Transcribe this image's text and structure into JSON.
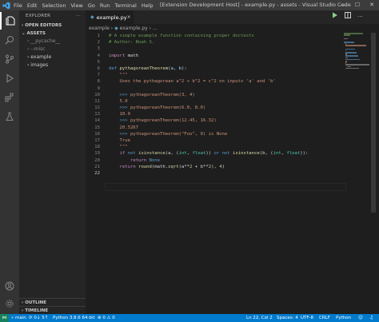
{
  "titlebar": {
    "menu": [
      "File",
      "Edit",
      "Selection",
      "View",
      "Go",
      "Run",
      "Terminal",
      "Help"
    ],
    "title": "[Extension Development Host] - example.py - assets - Visual Studio Code",
    "minimize": "—",
    "maximize": "☐",
    "close": "✕"
  },
  "sidebar": {
    "header": "EXPLORER",
    "more": "···",
    "open_editors": "OPEN EDITORS",
    "folder": "ASSETS",
    "items": [
      {
        "label": "› __pycache__",
        "dim": true
      },
      {
        "label": "› --misc",
        "dim": true
      },
      {
        "label": "› example",
        "dim": false
      },
      {
        "label": "› images",
        "dim": false
      }
    ],
    "outline": "OUTLINE",
    "timeline": "TIMELINE"
  },
  "tabs": [
    {
      "label": "example.py",
      "icon": "python-file-icon"
    }
  ],
  "tab_close": "×",
  "breadcrumb": {
    "folder": "example",
    "sep": "›",
    "file": "example.py",
    "sep2": "›",
    "symbol": "..."
  },
  "code_lines": [
    [
      {
        "t": "# A simple example function containing proper doctests",
        "c": "c-comment"
      }
    ],
    [
      {
        "t": "# Author: Noah S.",
        "c": "c-comment"
      }
    ],
    [],
    [
      {
        "t": "import",
        "c": "c-kw"
      },
      {
        "t": " math",
        "c": "c-plain"
      }
    ],
    [],
    [
      {
        "t": "def",
        "c": "c-def"
      },
      {
        "t": " ",
        "c": "c-plain"
      },
      {
        "t": "pythagoreanTheorem",
        "c": "c-fn"
      },
      {
        "t": "(",
        "c": "c-plain"
      },
      {
        "t": "a",
        "c": "c-param"
      },
      {
        "t": ", ",
        "c": "c-plain"
      },
      {
        "t": "b",
        "c": "c-param"
      },
      {
        "t": "):",
        "c": "c-plain"
      }
    ],
    [
      {
        "t": "    \"\"\"",
        "c": "c-doc"
      }
    ],
    [
      {
        "t": "    Uses the pythagorean a^2 + b^2 = c^2 on inputs 'a' and 'b'",
        "c": "c-doc"
      }
    ],
    [],
    [
      {
        "t": "    >>> ",
        "c": "c-def"
      },
      {
        "t": "pythagoreanTheorem(3, 4)",
        "c": "c-doc"
      }
    ],
    [
      {
        "t": "    5.0",
        "c": "c-doc"
      }
    ],
    [
      {
        "t": "    >>> ",
        "c": "c-def"
      },
      {
        "t": "pythagoreanTheorem(6.0, 8.0)",
        "c": "c-doc"
      }
    ],
    [
      {
        "t": "    10.0",
        "c": "c-doc"
      }
    ],
    [
      {
        "t": "    >>> ",
        "c": "c-def"
      },
      {
        "t": "pythagoreanTheorem(12.45, 16.32)",
        "c": "c-doc"
      }
    ],
    [
      {
        "t": "    20.5267",
        "c": "c-doc"
      }
    ],
    [
      {
        "t": "    >>> ",
        "c": "c-def"
      },
      {
        "t": "pythagoreanTheorem(\"Foo\", 9) is None",
        "c": "c-doc"
      }
    ],
    [
      {
        "t": "    True",
        "c": "c-doc"
      }
    ],
    [
      {
        "t": "    \"\"\"",
        "c": "c-doc"
      }
    ],
    [
      {
        "t": "    ",
        "c": "c-plain"
      },
      {
        "t": "if",
        "c": "c-kw"
      },
      {
        "t": " ",
        "c": "c-plain"
      },
      {
        "t": "not",
        "c": "c-def"
      },
      {
        "t": " ",
        "c": "c-plain"
      },
      {
        "t": "isinstance",
        "c": "c-fn"
      },
      {
        "t": "(a, (",
        "c": "c-plain"
      },
      {
        "t": "int",
        "c": "c-cls"
      },
      {
        "t": ", ",
        "c": "c-plain"
      },
      {
        "t": "float",
        "c": "c-cls"
      },
      {
        "t": ")) ",
        "c": "c-plain"
      },
      {
        "t": "or",
        "c": "c-def"
      },
      {
        "t": " ",
        "c": "c-plain"
      },
      {
        "t": "not",
        "c": "c-def"
      },
      {
        "t": " ",
        "c": "c-plain"
      },
      {
        "t": "isinstance",
        "c": "c-fn"
      },
      {
        "t": "(b, (",
        "c": "c-plain"
      },
      {
        "t": "int",
        "c": "c-cls"
      },
      {
        "t": ", ",
        "c": "c-plain"
      },
      {
        "t": "float",
        "c": "c-cls"
      },
      {
        "t": ")):",
        "c": "c-plain"
      }
    ],
    [
      {
        "t": "        ",
        "c": "c-plain"
      },
      {
        "t": "return",
        "c": "c-kw"
      },
      {
        "t": " ",
        "c": "c-plain"
      },
      {
        "t": "None",
        "c": "c-def"
      }
    ],
    [
      {
        "t": "    ",
        "c": "c-plain"
      },
      {
        "t": "return",
        "c": "c-kw"
      },
      {
        "t": " ",
        "c": "c-plain"
      },
      {
        "t": "round",
        "c": "c-fn"
      },
      {
        "t": "(math.",
        "c": "c-plain"
      },
      {
        "t": "sqrt",
        "c": "c-fn"
      },
      {
        "t": "(a**",
        "c": "c-plain"
      },
      {
        "t": "2",
        "c": "c-num"
      },
      {
        "t": " + b**",
        "c": "c-plain"
      },
      {
        "t": "2",
        "c": "c-num"
      },
      {
        "t": "), ",
        "c": "c-plain"
      },
      {
        "t": "4",
        "c": "c-num"
      },
      {
        "t": ")",
        "c": "c-plain"
      }
    ],
    []
  ],
  "current_line": 22,
  "statusbar": {
    "remote": "⋈",
    "branch": "⑂ main",
    "sync": "⟳ 0↓ 5↑",
    "python": "Python 3.8.6 64-bit",
    "problems": "⊗ 0 ⚠ 0",
    "position": "Ln 22, Col 2",
    "spaces": "Spaces: 4",
    "encoding": "UTF-8",
    "eol": "CRLF",
    "language": "Python"
  }
}
